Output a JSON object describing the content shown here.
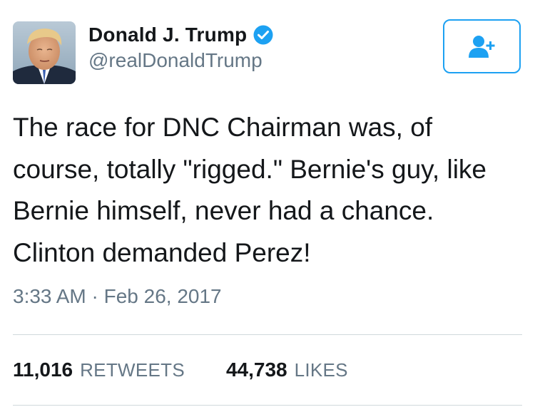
{
  "author": {
    "display_name": "Donald J. Trump",
    "handle": "@realDonaldTrump",
    "verified": true,
    "avatar_icon": "profile-photo"
  },
  "follow_button": {
    "icon": "add-user-icon",
    "color": "#1da1f2"
  },
  "tweet": {
    "lines": [
      "The race for DNC Chairman was, of",
      "course, totally \"rigged.\" Bernie's guy, like",
      "Bernie himself, never had a chance.",
      "Clinton demanded Perez!"
    ],
    "timestamp": "3:33 AM · Feb 26, 2017"
  },
  "stats": {
    "retweets_count": "11,016",
    "retweets_label": "RETWEETS",
    "likes_count": "44,738",
    "likes_label": "LIKES"
  },
  "colors": {
    "text_primary": "#14171a",
    "text_secondary": "#657786",
    "accent": "#1da1f2",
    "divider": "#cfd8dc"
  }
}
